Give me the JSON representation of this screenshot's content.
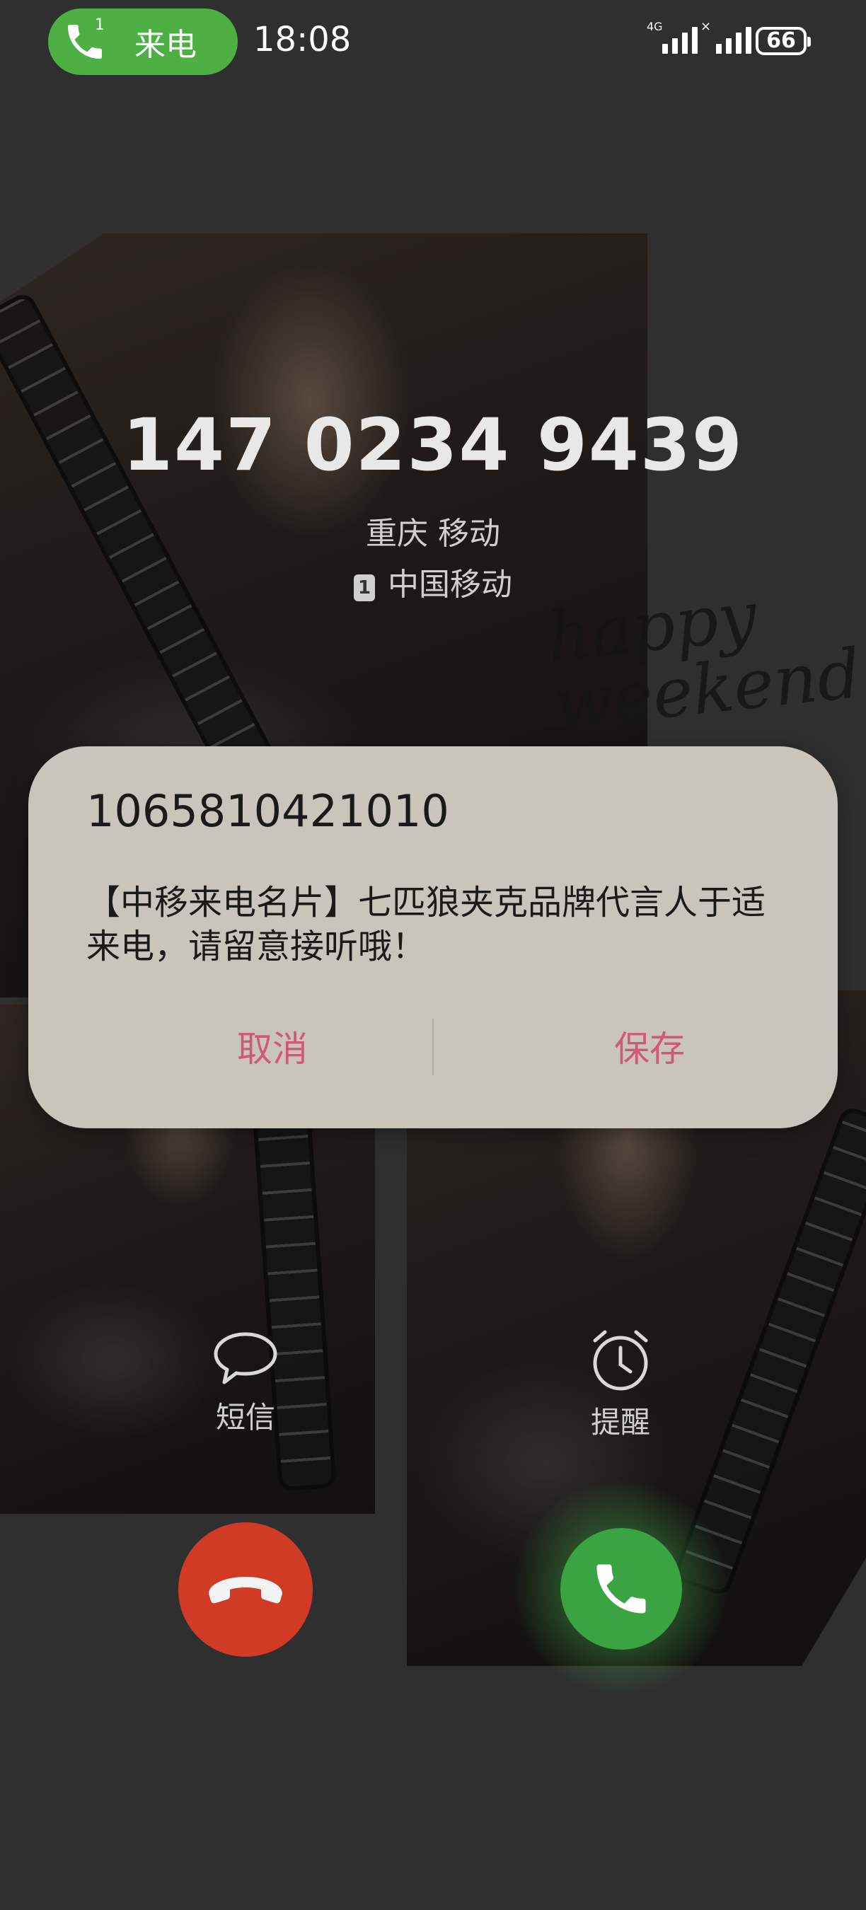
{
  "status_bar": {
    "call_pill_label": "来电",
    "call_pill_sim": "1",
    "time": "18:08",
    "network_type": "4G",
    "battery": "66"
  },
  "background": {
    "decor_text_line1": "happy",
    "decor_text_line2": "weekend"
  },
  "caller": {
    "number": "147 0234 9439",
    "location": "重庆 移动",
    "sim_badge": "1",
    "carrier": "中国移动"
  },
  "dialog": {
    "title": "1065810421010",
    "message": "【中移来电名片】七匹狼夹克品牌代言人于适来电，请留意接听哦！",
    "cancel_label": "取消",
    "save_label": "保存"
  },
  "actions": {
    "sms_label": "短信",
    "remind_label": "提醒"
  },
  "colors": {
    "accept": "#3aa443",
    "decline": "#d13a25",
    "dialog_button": "#d05a74",
    "pill": "#4cb043"
  }
}
